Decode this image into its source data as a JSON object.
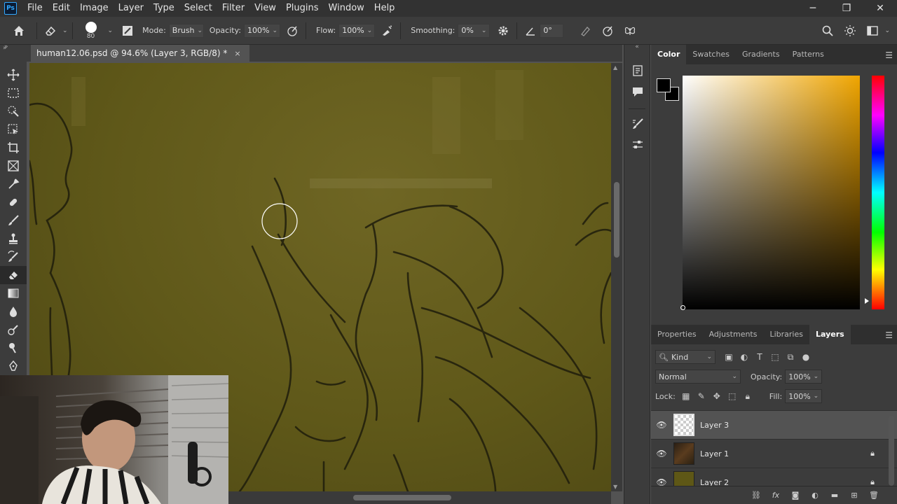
{
  "app": {
    "logo": "Ps"
  },
  "menu": [
    "File",
    "Edit",
    "Image",
    "Layer",
    "Type",
    "Select",
    "Filter",
    "View",
    "Plugins",
    "Window",
    "Help"
  ],
  "window": {
    "minimize": "─",
    "restore": "❐",
    "close": "✕"
  },
  "options": {
    "brush_size": "80",
    "mode_label": "Mode:",
    "mode_value": "Brush",
    "opacity_label": "Opacity:",
    "opacity_value": "100%",
    "flow_label": "Flow:",
    "flow_value": "100%",
    "smoothing_label": "Smoothing:",
    "smoothing_value": "0%",
    "angle_value": "0°"
  },
  "document": {
    "tab_title": "human12.06.psd @ 94.6% (Layer 3, RGB/8) *",
    "close": "×"
  },
  "color_panel": {
    "tabs": [
      "Color",
      "Swatches",
      "Gradients",
      "Patterns"
    ],
    "active_tab": "Color",
    "foreground": "#000000",
    "background": "#000000",
    "hue": "#f0a500"
  },
  "layers_panel": {
    "tabs": [
      "Properties",
      "Adjustments",
      "Libraries",
      "Layers"
    ],
    "active_tab": "Layers",
    "filter_kind": "Kind",
    "blend_mode": "Normal",
    "opacity_label": "Opacity:",
    "opacity_value": "100%",
    "lock_label": "Lock:",
    "fill_label": "Fill:",
    "fill_value": "100%",
    "layers": [
      {
        "name": "Layer 3",
        "selected": true,
        "locked": false
      },
      {
        "name": "Layer 1",
        "selected": false,
        "locked": true
      },
      {
        "name": "Layer 2",
        "selected": false,
        "locked": true
      }
    ]
  }
}
